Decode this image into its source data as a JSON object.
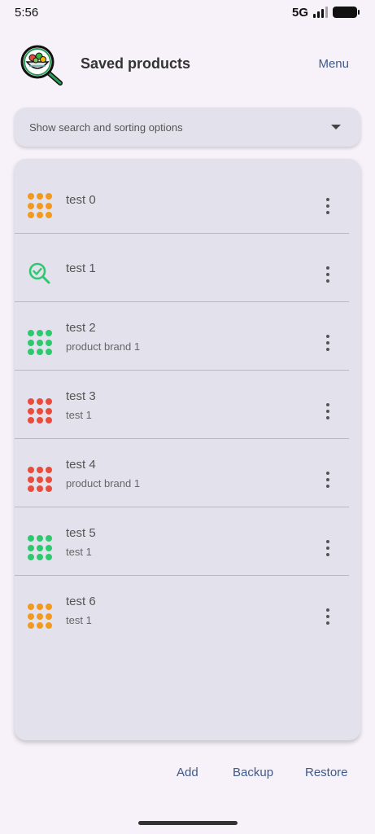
{
  "status_bar": {
    "time": "5:56",
    "network": "5G"
  },
  "header": {
    "title": "Saved products",
    "menu_label": "Menu"
  },
  "search": {
    "label": "Show search and sorting options"
  },
  "colors": {
    "orange": "#f29a1f",
    "green": "#2ec96f",
    "red": "#e74c3c",
    "accent": "#3d5a8a"
  },
  "products": [
    {
      "title": "test 0",
      "subtitle": "",
      "icon": "grid-dots-icon",
      "color": "#f29a1f"
    },
    {
      "title": "test 1",
      "subtitle": "",
      "icon": "search-check-icon",
      "color": "#2ec96f"
    },
    {
      "title": "test 2",
      "subtitle": "product brand 1",
      "icon": "grid-dots-icon",
      "color": "#2ec96f"
    },
    {
      "title": "test 3",
      "subtitle": "test 1",
      "icon": "grid-dots-icon",
      "color": "#e74c3c"
    },
    {
      "title": "test 4",
      "subtitle": "product brand 1",
      "icon": "grid-dots-icon",
      "color": "#e74c3c"
    },
    {
      "title": "test 5",
      "subtitle": "test 1",
      "icon": "grid-dots-icon",
      "color": "#2ec96f"
    },
    {
      "title": "test 6",
      "subtitle": "test 1",
      "icon": "grid-dots-icon",
      "color": "#f29a1f"
    }
  ],
  "actions": {
    "add": "Add",
    "backup": "Backup",
    "restore": "Restore"
  }
}
